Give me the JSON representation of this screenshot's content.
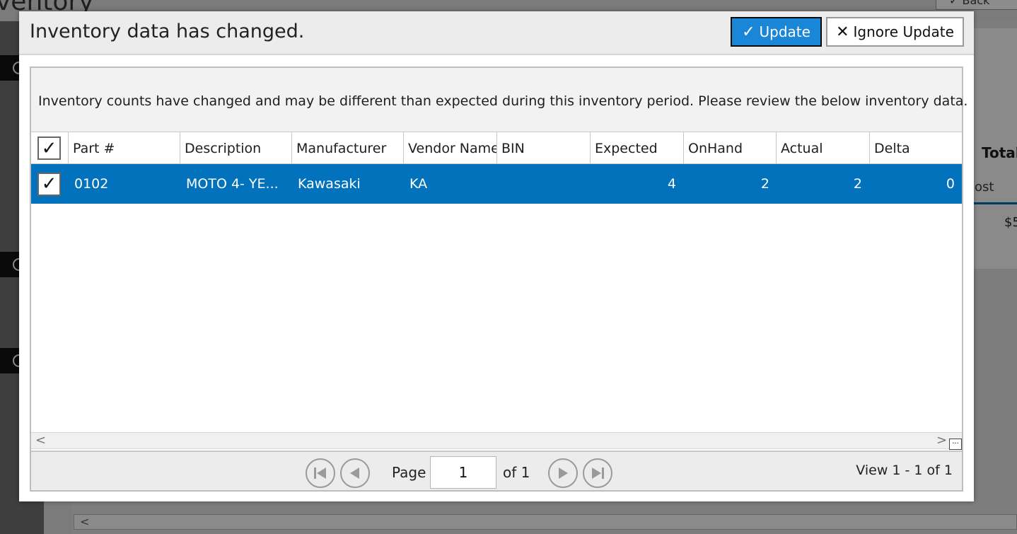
{
  "background": {
    "title": "ventory",
    "back_label": "✓ Back",
    "total_label": "Total",
    "cost_label": "ost",
    "money_label": "$5",
    "scroll_left": "<"
  },
  "dialog": {
    "title": "Inventory data has changed.",
    "update_label": "Update",
    "ignore_label": "Ignore Update",
    "message": "Inventory counts have changed and may be different than expected during this inventory period. Please review the below inventory data."
  },
  "grid": {
    "columns": [
      "Part #",
      "Description",
      "Manufacturer",
      "Vendor Name",
      "BIN",
      "Expected",
      "OnHand",
      "Actual",
      "Delta"
    ],
    "rows": [
      {
        "checked": true,
        "part": "0102",
        "description": "MOTO 4- YE...",
        "manufacturer": "Kawasaki",
        "vendor": "KA",
        "bin": "",
        "expected": "4",
        "onhand": "2",
        "actual": "2",
        "delta": "0"
      }
    ],
    "scroll_left": "<",
    "scroll_right": ">",
    "more": "..."
  },
  "pager": {
    "page_label": "Page",
    "page_value": "1",
    "of_label": "of 1",
    "view_label": "View 1 - 1 of 1"
  },
  "colors": {
    "accent": "#1a86d8",
    "selected_row": "#0172bb"
  }
}
